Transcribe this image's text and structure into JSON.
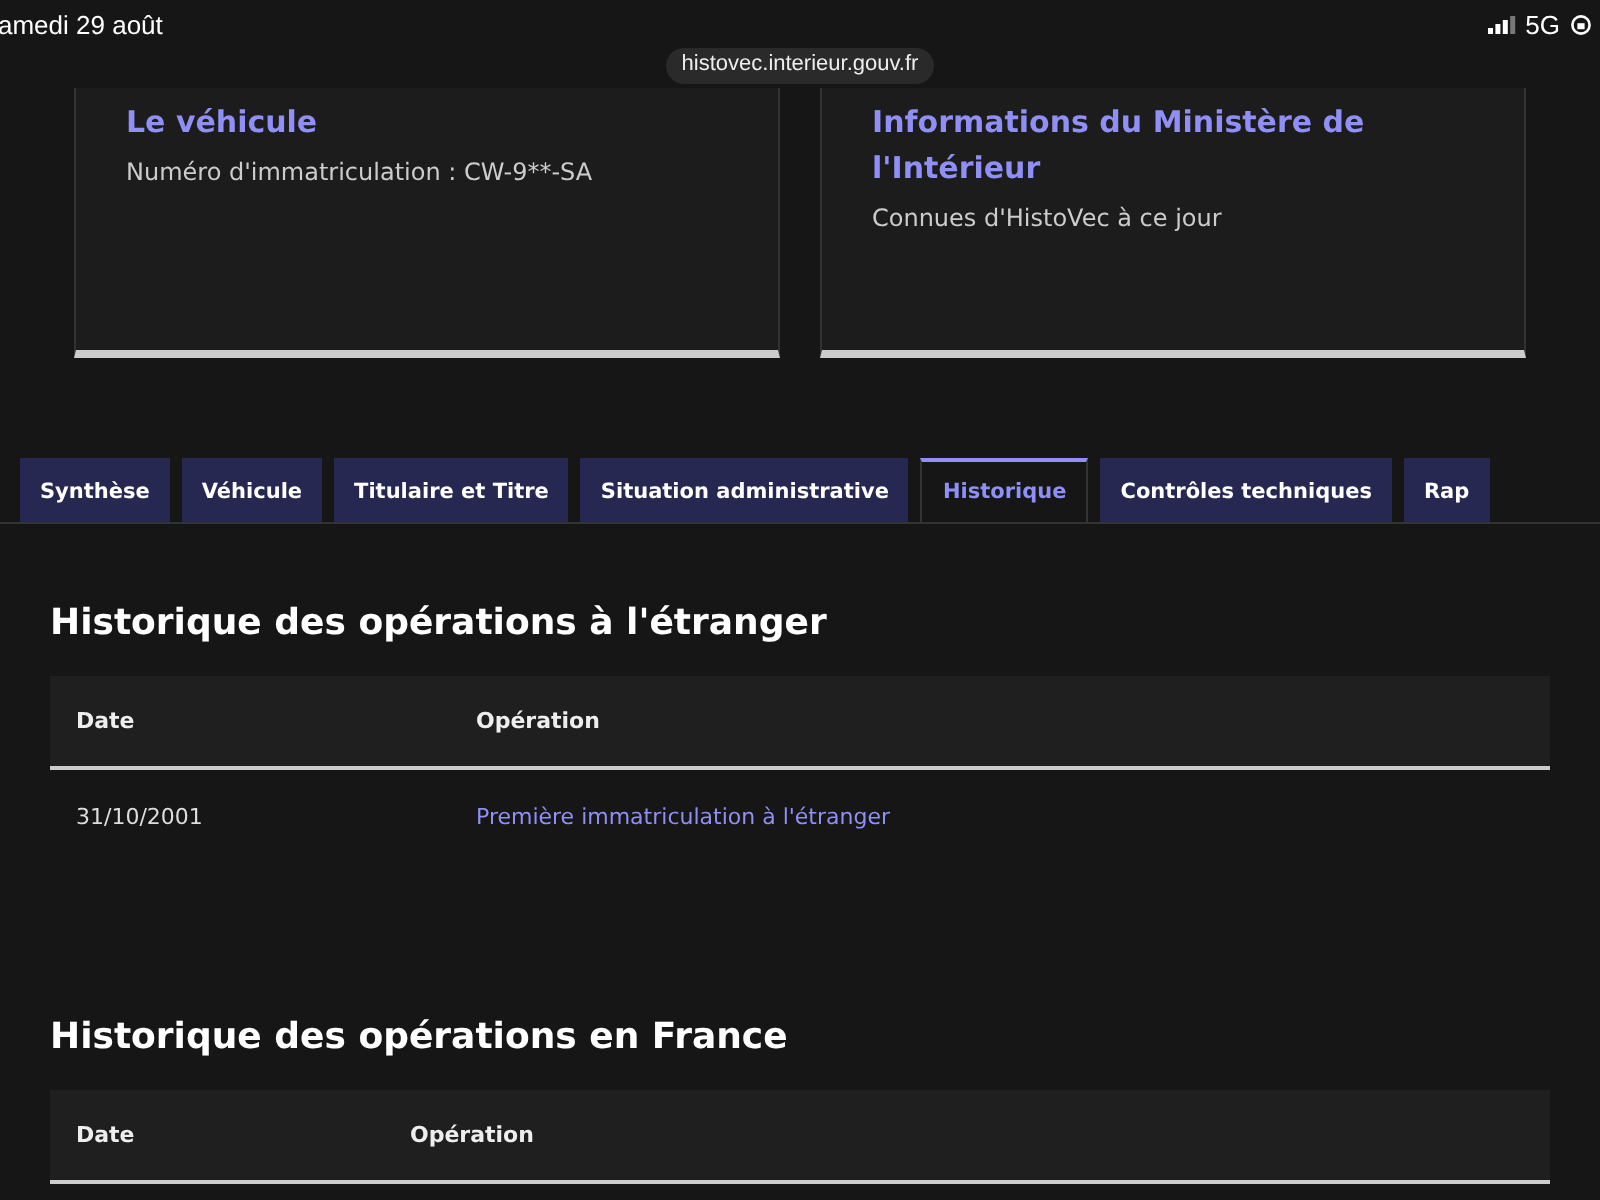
{
  "status_bar": {
    "date": "amedi 29 août",
    "network": "5G"
  },
  "address_bar": {
    "url": "histovec.interieur.gouv.fr"
  },
  "cards": [
    {
      "title": "Le véhicule",
      "text": "Numéro d'immatriculation : CW-9**-SA"
    },
    {
      "title": "Informations du Ministère de l'Intérieur",
      "text": "Connues d'HistoVec à ce jour"
    }
  ],
  "tabs": [
    {
      "label": "Synthèse",
      "selected": false
    },
    {
      "label": "Véhicule",
      "selected": false
    },
    {
      "label": "Titulaire et Titre",
      "selected": false
    },
    {
      "label": "Situation administrative",
      "selected": false
    },
    {
      "label": "Historique",
      "selected": true
    },
    {
      "label": "Contrôles techniques",
      "selected": false
    },
    {
      "label": "Rap",
      "selected": false
    }
  ],
  "sections": [
    {
      "title": "Historique des opérations à l'étranger",
      "columns": [
        "Date",
        "Opération"
      ],
      "rows": [
        [
          "31/10/2001",
          "Première immatriculation à l'étranger"
        ]
      ]
    },
    {
      "title": "Historique des opérations en France",
      "columns": [
        "Date",
        "Opération"
      ]
    }
  ]
}
